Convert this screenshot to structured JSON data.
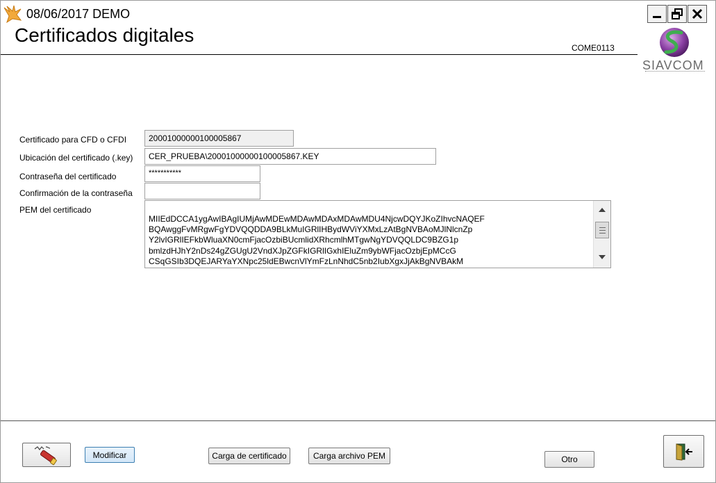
{
  "titlebar": {
    "title": "08/06/2017  DEMO",
    "icon": "app-logo-icon",
    "controls": [
      "minimize-icon",
      "restore-icon",
      "close-icon"
    ]
  },
  "header": {
    "title": "Certificados digitales",
    "code": "COME0113",
    "logo_text": "SIAVCOM"
  },
  "form": {
    "cert_label": "Certificado para CFD o CFDI",
    "cert_value": "20001000000100005867",
    "location_label": "Ubicación del  certificado (.key)",
    "location_value": "CER_PRUEBA\\20001000000100005867.KEY",
    "password_label": "Contraseña del certificado",
    "password_value": "***********",
    "confirm_label": "Confirmación de la contraseña",
    "confirm_value": "",
    "pem_label": "PEM del certificado",
    "pem_value": "MIIEdDCCA1ygAwIBAgIUMjAwMDEwMDAwMDAxMDAwMDU4NjcwDQYJKoZIhvcNAQEF\nBQAwggFvMRgwFgYDVQQDDA9BLkMuIGRlIHBydWViYXMxLzAtBgNVBAoMJlNlcnZp\nY2lvIGRlIEFkbWluaXN0cmFjacOzbiBUcmlidXRhcmlhMTgwNgYDVQQLDC9BZG1p\nbmlzdHJhY2nDs24gZGUgU2VndXJpZGFkIGRlIGxhIEluZm9ybWFjacOzbjEpMCcG\nCSqGSIb3DQEJARYaYXNpc25ldEBwcnVlYmFzLnNhdC5nb2IubXgxJjAkBgNVBAkM"
  },
  "buttons": {
    "modify": "Modificar",
    "load_cert": "Carga de certificado",
    "load_pem": "Carga archivo PEM",
    "other": "Otro",
    "edit_icon": "edit-pen-icon",
    "exit_icon": "exit-door-icon"
  }
}
